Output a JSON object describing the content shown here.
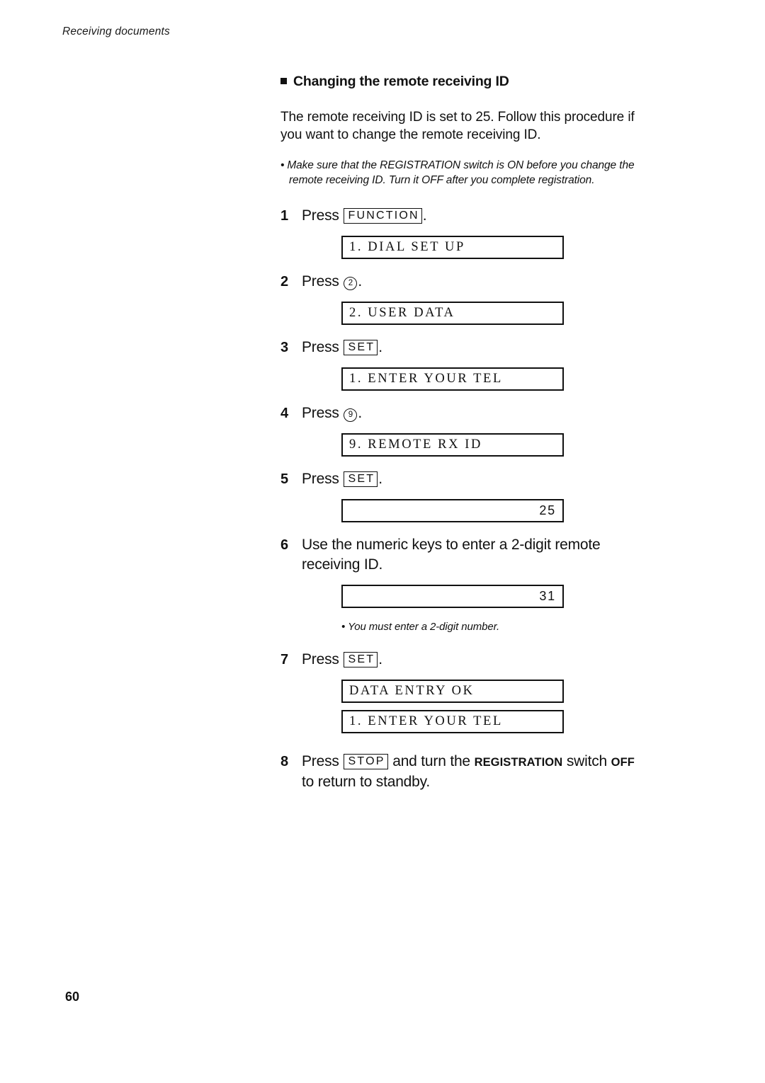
{
  "running_head": "Receiving documents",
  "page_number": "60",
  "section": {
    "heading": "Changing the remote receiving ID",
    "intro": "The remote receiving ID is set to 25. Follow this procedure if you want to change the remote receiving ID.",
    "note": "Make sure that the REGISTRATION switch is ON before you change the remote receiving ID. Turn it OFF after you complete registration.",
    "note_bullet": "•"
  },
  "steps": [
    {
      "num": "1",
      "text_before": "Press",
      "key": "FUNCTION",
      "key_type": "keycap",
      "text_after": ".",
      "displays": [
        "1. DIAL SET UP"
      ]
    },
    {
      "num": "2",
      "text_before": "Press",
      "key": "2",
      "key_type": "circle",
      "text_after": ".",
      "displays": [
        "2. USER DATA"
      ]
    },
    {
      "num": "3",
      "text_before": "Press",
      "key": "SET",
      "key_type": "keycap",
      "text_after": ".",
      "displays": [
        "1. ENTER YOUR TEL"
      ]
    },
    {
      "num": "4",
      "text_before": "Press",
      "key": "9",
      "key_type": "circle",
      "text_after": ".",
      "displays": [
        "9. REMOTE RX ID"
      ]
    },
    {
      "num": "5",
      "text_before": "Press",
      "key": "SET",
      "key_type": "keycap",
      "text_after": ".",
      "displays": [
        "25"
      ],
      "display_align": "right"
    },
    {
      "num": "6",
      "text_before": "Use the numeric keys to enter a 2-digit remote receiving ID.",
      "key": "",
      "key_type": "none",
      "text_after": "",
      "displays": [
        "31"
      ],
      "display_align": "right",
      "note": "You must enter a 2-digit number."
    },
    {
      "num": "7",
      "text_before": "Press",
      "key": "SET",
      "key_type": "keycap",
      "text_after": ".",
      "displays": [
        "DATA ENTRY OK",
        "1. ENTER YOUR TEL"
      ]
    },
    {
      "num": "8",
      "text_before": "Press",
      "key": "STOP",
      "key_type": "keycap",
      "text_after_parts": {
        "plain1": " and turn the ",
        "emph1": "REGISTRATION",
        "plain2": " switch ",
        "emph2": "OFF",
        "plain3": " to return to standby."
      },
      "displays": []
    }
  ],
  "step6_note_bullet": "•"
}
